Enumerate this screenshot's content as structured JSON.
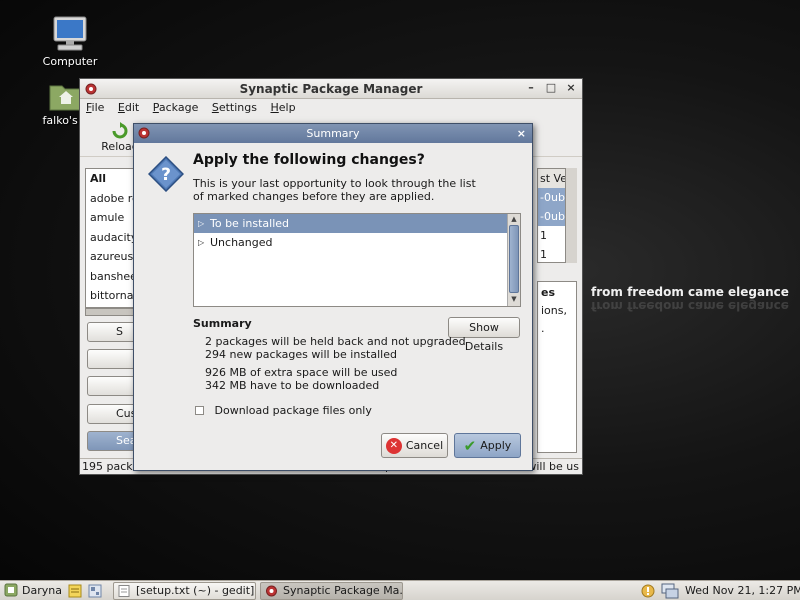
{
  "desktop": {
    "icons": [
      {
        "label": "Computer"
      },
      {
        "label": "falko's H"
      }
    ],
    "slogan": "from freedom came elegance",
    "slogan_reflection": "from freedom came elegance"
  },
  "main_window": {
    "title": "Synaptic Package Manager",
    "menu": [
      {
        "key": "F",
        "rest": "ile"
      },
      {
        "key": "E",
        "rest": "dit"
      },
      {
        "key": "P",
        "rest": "ackage"
      },
      {
        "key": "S",
        "rest": "ettings"
      },
      {
        "key": "H",
        "rest": "elp"
      }
    ],
    "toolbar": {
      "reload_label": "Reload"
    },
    "filter_list": [
      "All",
      "adobe re",
      "amule",
      "audacity",
      "azureus",
      "banshee",
      "bittornad"
    ],
    "side_buttons": [
      "S",
      "",
      "",
      "Cus",
      "Sea"
    ],
    "package_column": {
      "header": "st Ver",
      "rows": [
        "-0ubu",
        "-0ubu",
        "1",
        "1"
      ]
    },
    "description_panel": [
      "es",
      "ions,",
      "."
    ],
    "status_left": "195 packa",
    "status_mid": "p",
    "status_right": "will be us"
  },
  "dialog": {
    "title": "Summary",
    "heading": "Apply the following changes?",
    "description_line1": "This is your last opportunity to look through the list",
    "description_line2": "of marked changes before they are applied.",
    "tree": [
      {
        "label": "To be installed",
        "selected": true
      },
      {
        "label": "Unchanged",
        "selected": false
      }
    ],
    "summary_title": "Summary",
    "show_details_label": "Show Details",
    "summary_lines": [
      "2 packages will be held back and not upgraded",
      "294 new packages will be installed",
      "926 MB of extra space will be used",
      "342 MB have to be downloaded"
    ],
    "download_only_label": "Download package files only",
    "download_only_checked": false,
    "cancel_label": "Cancel",
    "apply_label": "Apply"
  },
  "taskbar": {
    "user": "Daryna",
    "tasks": [
      {
        "label": "[setup.txt (~) - gedit]",
        "active": false
      },
      {
        "label": "Synaptic Package Ma...",
        "active": true
      }
    ],
    "clock": "Wed Nov 21,  1:27 PM"
  },
  "colors": {
    "selection": "#7a93b7",
    "dialog_title": "#62789c",
    "cancel_red": "#dd3333",
    "apply_green": "#3a9a2a"
  }
}
